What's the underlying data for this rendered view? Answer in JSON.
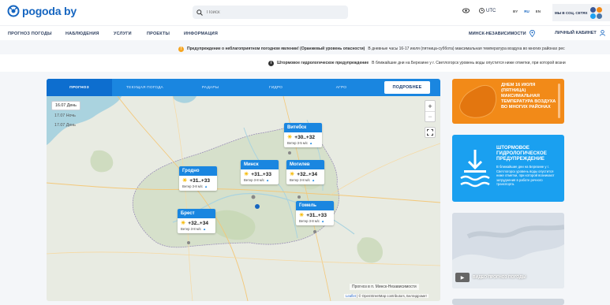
{
  "header": {
    "logo": "pogoda by",
    "search_placeholder": "Поиск",
    "utc_label": "UTC",
    "langs": [
      "BY",
      "RU",
      "EN"
    ],
    "social_label": "МЫ В СОЦ. СЕТЯХ"
  },
  "nav": {
    "items": [
      "ПРОГНОЗ ПОГОДЫ",
      "НАБЛЮДЕНИЯ",
      "УСЛУГИ",
      "ПРОЕКТЫ",
      "ИНФОРМАЦИЯ"
    ],
    "city": "МИНСК-НЕЗАВИСИМОСТИ",
    "account": "ЛИЧНЫЙ КАБИНЕТ"
  },
  "warnings": [
    {
      "title": "Предупреждение о неблагоприятном погодном явлении! (Оранжевый уровень опасности)",
      "text": "В дневные часы 16-17 июля (пятница-суббота) максимальная температура воздуха во многих районах рес"
    },
    {
      "title": "Штормовое гидрологическое предупреждение",
      "text": "В ближайшие дни на Березине у г. Светлогорск уровень воды опустится ниже отметки, при которой возни"
    }
  ],
  "tabs": [
    "ПРОГНОЗ",
    "ТЕКУЩАЯ ПОГОДА",
    "РАДАРЫ",
    "ГИДРО",
    "АГРО"
  ],
  "more_button": "ПОДРОБНЕЕ",
  "days": [
    "16.07 День",
    "17.07 Ночь",
    "17.07 День"
  ],
  "cities": [
    {
      "name": "Витебск",
      "temp": "+30..+32",
      "wind": "Ветер 3-5 м/с"
    },
    {
      "name": "Гродно",
      "temp": "+31..+33",
      "wind": "Ветер 3-8 м/с"
    },
    {
      "name": "Минск",
      "temp": "+31..+33",
      "wind": "Ветер 3-8 м/с"
    },
    {
      "name": "Могилев",
      "temp": "+32..+34",
      "wind": "Ветер 3-8 м/с"
    },
    {
      "name": "Брест",
      "temp": "+32..+34",
      "wind": "Ветер 3-8 м/с"
    },
    {
      "name": "Гомель",
      "temp": "+31..+33",
      "wind": "Ветер 3-8 м/с"
    }
  ],
  "map_caption": "Прогноз в п. Минск-Независимости",
  "attribution": {
    "leaflet": "Leaflet",
    "text": " | © OpenStreetMap contributors, Белгидромет"
  },
  "card1": {
    "text": "ДНЕМ 16 ИЮЛЯ (ПЯТНИЦА) МАКСИМАЛЬНАЯ ТЕМПЕРАТУРА ВОЗДУХА ВО МНОГИХ РАЙОНАХ"
  },
  "card2": {
    "title": "ШТОРМОВОЕ ГИДРОЛОГИЧЕСКОЕ ПРЕДУПРЕЖДЕНИЕ",
    "text": "В ближайшие дни на Березине у г. Светлогорск уровень воды опустится ниже отметки, при которой возникают затруднения в работе речного транспорта."
  },
  "card3": {
    "video_label": "ВИДЕО ПРОГНОЗ ПОГОДЫ"
  },
  "colors": {
    "brand": "#1565c0",
    "tab_bar": "#1a86e0",
    "orange": "#f28a18",
    "hydro_blue": "#1aa0f0",
    "warning_orange": "#f6a623",
    "accent_yellow": "#f5b800"
  }
}
